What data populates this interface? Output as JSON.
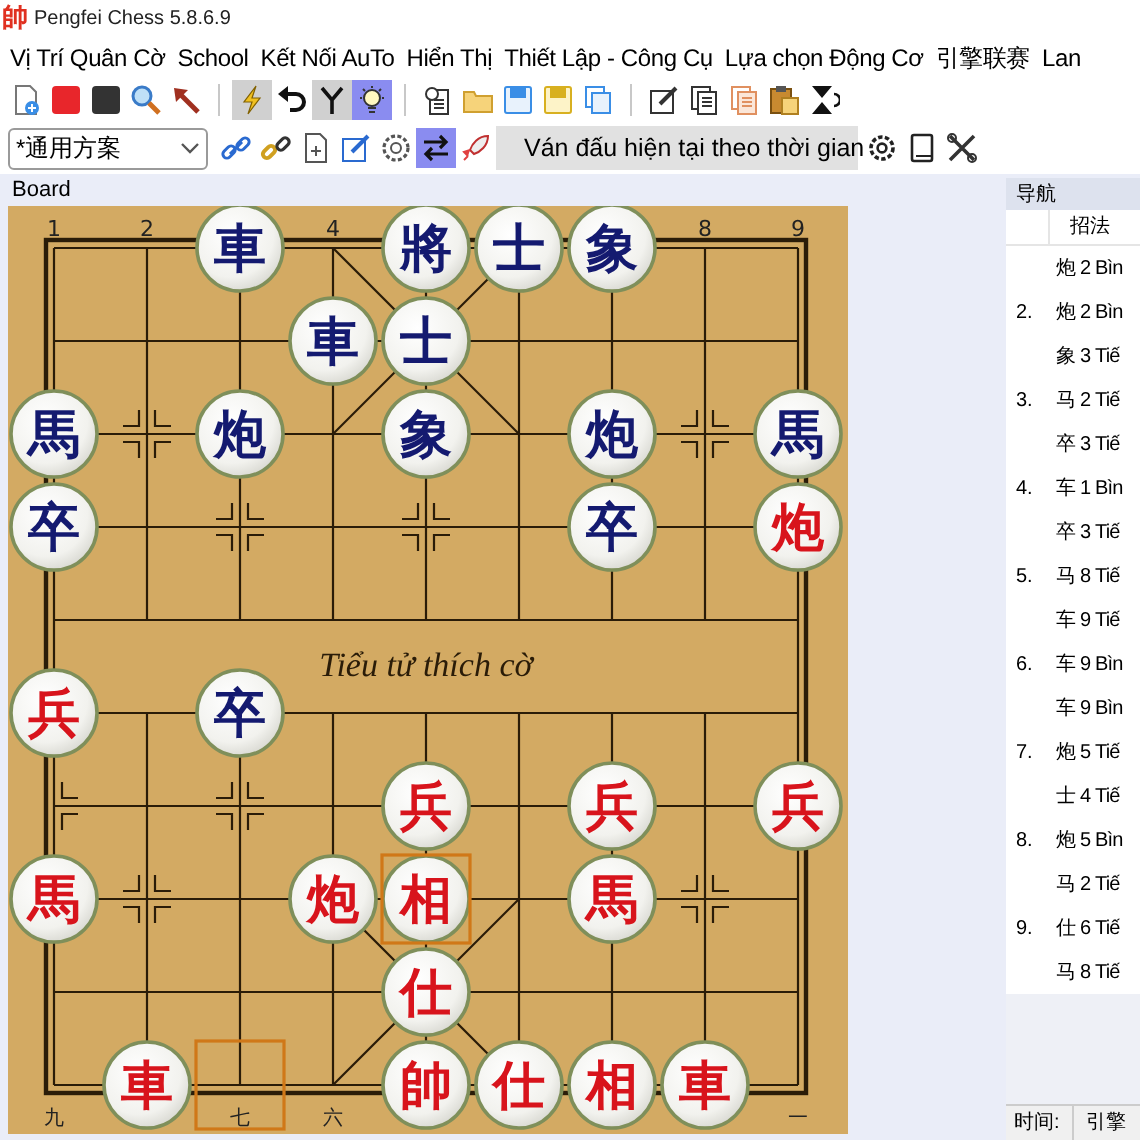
{
  "window": {
    "title": "Pengfei Chess 5.8.6.9",
    "icon": "帥"
  },
  "menu": [
    "Vị Trí Quân Cờ",
    "School",
    "Kết Nối AuTo",
    "Hiển Thị",
    "Thiết Lập - Công Cụ",
    "Lựa chọn Động Cơ",
    "引擎联赛",
    "Lan"
  ],
  "toolbar_1": [
    {
      "kind": "new",
      "pressed": false,
      "highlighted": false
    },
    {
      "kind": "red",
      "pressed": false,
      "highlighted": false
    },
    {
      "kind": "black",
      "pressed": false,
      "highlighted": false
    },
    {
      "kind": "search",
      "pressed": false,
      "highlighted": false
    },
    {
      "kind": "arrow",
      "pressed": false,
      "highlighted": false
    },
    {
      "kind": "separator"
    },
    {
      "kind": "lightning",
      "pressed": true,
      "highlighted": false
    },
    {
      "kind": "undo",
      "pressed": false,
      "highlighted": false
    },
    {
      "kind": "fork",
      "pressed": true,
      "highlighted": false
    },
    {
      "kind": "bulb",
      "pressed": false,
      "highlighted": true
    },
    {
      "kind": "separator"
    },
    {
      "kind": "clipboard",
      "pressed": false,
      "highlighted": false
    },
    {
      "kind": "folder",
      "pressed": false,
      "highlighted": false
    },
    {
      "kind": "save",
      "pressed": false,
      "highlighted": false
    },
    {
      "kind": "saveas",
      "pressed": false,
      "highlighted": false
    },
    {
      "kind": "copy",
      "pressed": false,
      "highlighted": false
    },
    {
      "kind": "separator"
    },
    {
      "kind": "edit",
      "pressed": false,
      "highlighted": false
    },
    {
      "kind": "pages",
      "pressed": false,
      "highlighted": false
    },
    {
      "kind": "pagesorange",
      "pressed": false,
      "highlighted": false
    },
    {
      "kind": "paste",
      "pressed": false,
      "highlighted": false
    },
    {
      "kind": "flip",
      "pressed": false,
      "highlighted": false
    }
  ],
  "toolbar_2": {
    "scheme": "*通用方案",
    "buttons": [
      {
        "kind": "link",
        "pressed": false,
        "highlighted": false
      },
      {
        "kind": "linkgold",
        "pressed": false,
        "highlighted": false
      },
      {
        "kind": "document",
        "pressed": false,
        "highlighted": false
      },
      {
        "kind": "editblue",
        "pressed": false,
        "highlighted": false
      },
      {
        "kind": "engine",
        "pressed": false,
        "highlighted": false
      },
      {
        "kind": "swap",
        "pressed": false,
        "highlighted": true
      },
      {
        "kind": "rocket",
        "pressed": false,
        "highlighted": false
      }
    ],
    "status": "Ván đấu hiện tại theo thời gian",
    "buttons_right": [
      {
        "kind": "gear",
        "pressed": false,
        "highlighted": false
      },
      {
        "kind": "book",
        "pressed": false,
        "highlighted": false
      },
      {
        "kind": "tools",
        "pressed": false,
        "highlighted": false
      }
    ]
  },
  "board": {
    "title": "Board",
    "river_text": "Tiểu tử thích cờ",
    "files": [
      {
        "top_label": "1",
        "bottom_label": "九",
        "cells": [
          null,
          null,
          {
            "piece": "馬",
            "color": "#141a70",
            "highlighted": false
          },
          {
            "piece": "卒",
            "color": "#141a70",
            "highlighted": false
          },
          null,
          {
            "piece": "兵",
            "color": "#d8141c",
            "highlighted": false
          },
          null,
          {
            "piece": "馬",
            "color": "#d8141c",
            "highlighted": false
          },
          null,
          null
        ]
      },
      {
        "top_label": "2",
        "cells": [
          null,
          null,
          null,
          null,
          null,
          null,
          null,
          null,
          null,
          {
            "piece": "車",
            "color": "#d8141c",
            "highlighted": false
          }
        ]
      },
      {
        "bottom_label": "七",
        "cells": [
          {
            "piece": "車",
            "color": "#141a70",
            "highlighted": false
          },
          null,
          {
            "piece": "炮",
            "color": "#141a70",
            "highlighted": false
          },
          null,
          null,
          {
            "piece": "卒",
            "color": "#141a70",
            "highlighted": false
          },
          null,
          null,
          null,
          {
            "highlighted": true
          }
        ]
      },
      {
        "top_label": "4",
        "bottom_label": "六",
        "cells": [
          null,
          {
            "piece": "車",
            "color": "#141a70",
            "highlighted": false
          },
          null,
          null,
          null,
          null,
          null,
          {
            "piece": "炮",
            "color": "#d8141c",
            "highlighted": false
          },
          null,
          null
        ]
      },
      {
        "cells": [
          {
            "piece": "將",
            "color": "#141a70",
            "highlighted": false
          },
          {
            "piece": "士",
            "color": "#141a70",
            "highlighted": false
          },
          {
            "piece": "象",
            "color": "#141a70",
            "highlighted": false
          },
          null,
          null,
          null,
          {
            "piece": "兵",
            "color": "#d8141c",
            "highlighted": false
          },
          {
            "piece": "相",
            "color": "#d8141c",
            "highlighted": true
          },
          {
            "piece": "仕",
            "color": "#d8141c",
            "highlighted": false
          },
          {
            "piece": "帥",
            "color": "#d8141c",
            "highlighted": false
          }
        ]
      },
      {
        "cells": [
          {
            "piece": "士",
            "color": "#141a70",
            "highlighted": false
          },
          null,
          null,
          null,
          null,
          null,
          null,
          null,
          null,
          {
            "piece": "仕",
            "color": "#d8141c",
            "highlighted": false
          }
        ]
      },
      {
        "cells": [
          {
            "piece": "象",
            "color": "#141a70",
            "highlighted": false
          },
          null,
          {
            "piece": "炮",
            "color": "#141a70",
            "highlighted": false
          },
          {
            "piece": "卒",
            "color": "#141a70",
            "highlighted": false
          },
          null,
          null,
          {
            "piece": "兵",
            "color": "#d8141c",
            "highlighted": false
          },
          {
            "piece": "馬",
            "color": "#d8141c",
            "highlighted": false
          },
          null,
          {
            "piece": "相",
            "color": "#d8141c",
            "highlighted": false
          }
        ]
      },
      {
        "top_label": "8",
        "cells": [
          null,
          null,
          null,
          null,
          null,
          null,
          null,
          null,
          null,
          {
            "piece": "車",
            "color": "#d8141c",
            "highlighted": false
          }
        ]
      },
      {
        "top_label": "9",
        "bottom_label": "一",
        "cells": [
          null,
          null,
          {
            "piece": "馬",
            "color": "#141a70",
            "highlighted": false
          },
          {
            "piece": "炮",
            "color": "#d8141c",
            "highlighted": false
          },
          null,
          null,
          {
            "piece": "兵",
            "color": "#d8141c",
            "highlighted": false
          },
          null,
          null,
          null
        ]
      }
    ]
  },
  "navigation": {
    "title": "导航",
    "column": "招法",
    "moves": [
      {
        "move": "炮 2 Bìn"
      },
      {
        "number": "2.",
        "move": "炮 2 Bìn"
      },
      {
        "move": "象 3 Tiế"
      },
      {
        "number": "3.",
        "move": "马 2 Tiế"
      },
      {
        "move": "卒 3 Tiế"
      },
      {
        "number": "4.",
        "move": "车 1 Bìn"
      },
      {
        "move": "卒 3 Tiế"
      },
      {
        "number": "5.",
        "move": "马 8 Tiế"
      },
      {
        "move": "车 9 Tiế"
      },
      {
        "number": "6.",
        "move": "车 9 Bìn"
      },
      {
        "move": "车 9 Bìn"
      },
      {
        "number": "7.",
        "move": "炮 5 Tiế"
      },
      {
        "move": "士 4 Tiế"
      },
      {
        "number": "8.",
        "move": "炮 5 Bìn"
      },
      {
        "move": "马 2 Tiế"
      },
      {
        "number": "9.",
        "move": "仕 6 Tiế"
      },
      {
        "move": "马 8 Tiế"
      }
    ],
    "footer": [
      "时间:",
      "引擎"
    ]
  }
}
